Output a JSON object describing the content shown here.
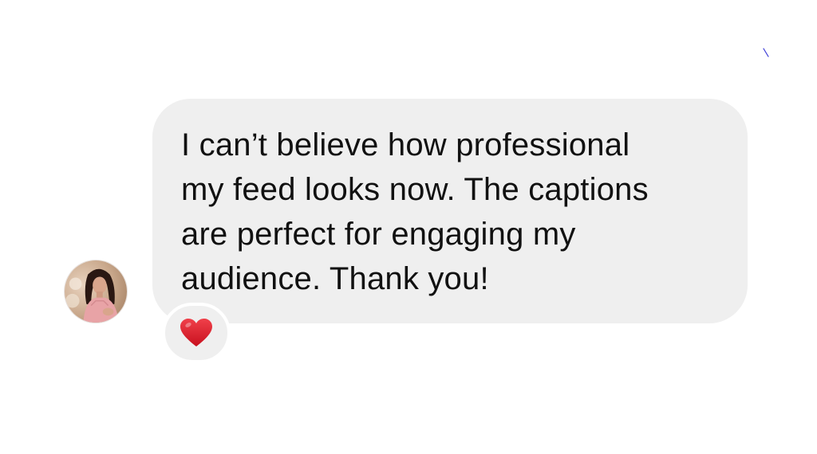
{
  "message": {
    "text": "I can’t believe how professional\nmy feed looks now. The captions\nare perfect for engaging my\naudience. Thank you!",
    "bubble_color": "#efefef",
    "text_color": "#111111"
  },
  "sender": {
    "avatar_icon": "profile-photo"
  },
  "reaction": {
    "icon": "red-heart-icon",
    "color": "#e0202e"
  },
  "colors": {
    "background": "#ffffff",
    "corner_mark": "#3b3bd6"
  }
}
